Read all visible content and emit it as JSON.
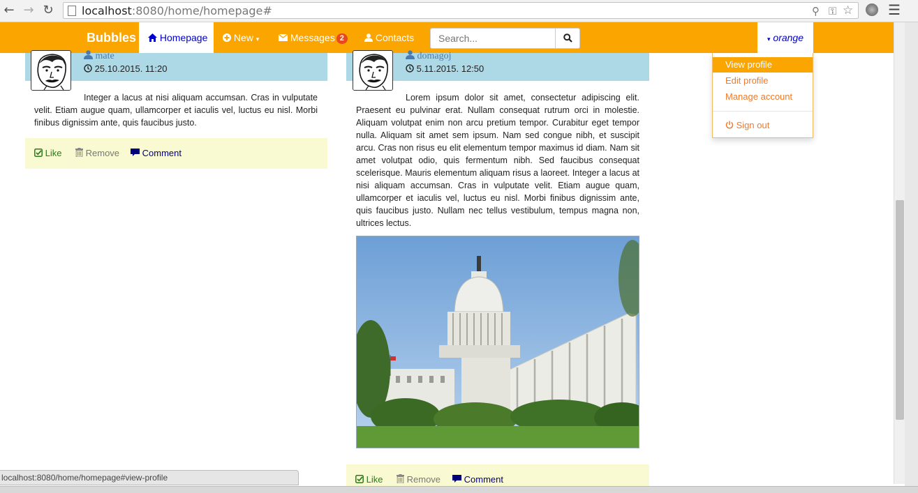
{
  "browser": {
    "url_host": "localhost",
    "url_rest": ":8080/home/homepage#",
    "status_text": "localhost:8080/home/homepage#view-profile"
  },
  "navbar": {
    "brand": "Bubbles",
    "items": [
      {
        "label": "Homepage",
        "icon": "home-icon"
      },
      {
        "label": "New",
        "icon": "plus-circle-icon"
      },
      {
        "label": "Messages",
        "icon": "envelope-icon",
        "badge": "2"
      },
      {
        "label": "Contacts",
        "icon": "user-icon"
      }
    ],
    "search_placeholder": "Search...",
    "user_label": "orange"
  },
  "user_menu": {
    "items": [
      "View profile",
      "Edit profile",
      "Manage account"
    ],
    "active": "View profile",
    "sign_out": "Sign out"
  },
  "posts": [
    {
      "author": "mate",
      "date": "25.10.2015. 11:20",
      "text": "Integer a lacus at nisi aliquam accumsan. Cras in vulputate velit. Etiam augue quam, ullamcorper et iaculis vel, luctus eu nisl. Morbi finibus dignissim ante, quis faucibus justo.",
      "actions": {
        "like": "Like",
        "remove": "Remove",
        "comment": "Comment"
      }
    },
    {
      "author": "domagoj",
      "date": "5.11.2015. 12:50",
      "text": "Lorem ipsum dolor sit amet, consectetur adipiscing elit. Praesent eu pulvinar erat. Nullam consequat rutrum orci in molestie. Aliquam volutpat enim non arcu pretium tempor. Curabitur eget tempor nulla. Aliquam sit amet sem ipsum. Nam sed congue nibh, et suscipit arcu. Cras non risus eu elit elementum tempor maximus id diam. Nam sit amet volutpat odio, quis fermentum nibh. Sed faucibus consequat scelerisque. Mauris elementum aliquam risus a laoreet. Integer a lacus at nisi aliquam accumsan. Cras in vulputate velit. Etiam augue quam, ullamcorper et iaculis vel, luctus eu nisl. Morbi finibus dignissim ante, quis faucibus justo. Nullam nec tellus vestibulum, tempus magna non, ultrices lectus.",
      "actions": {
        "like": "Like",
        "remove": "Remove",
        "comment": "Comment"
      }
    }
  ],
  "colors": {
    "navbar": "#fba500",
    "post_header": "#add8e6",
    "actions_bg": "#fafad2",
    "menu_text": "#f07a2a"
  }
}
